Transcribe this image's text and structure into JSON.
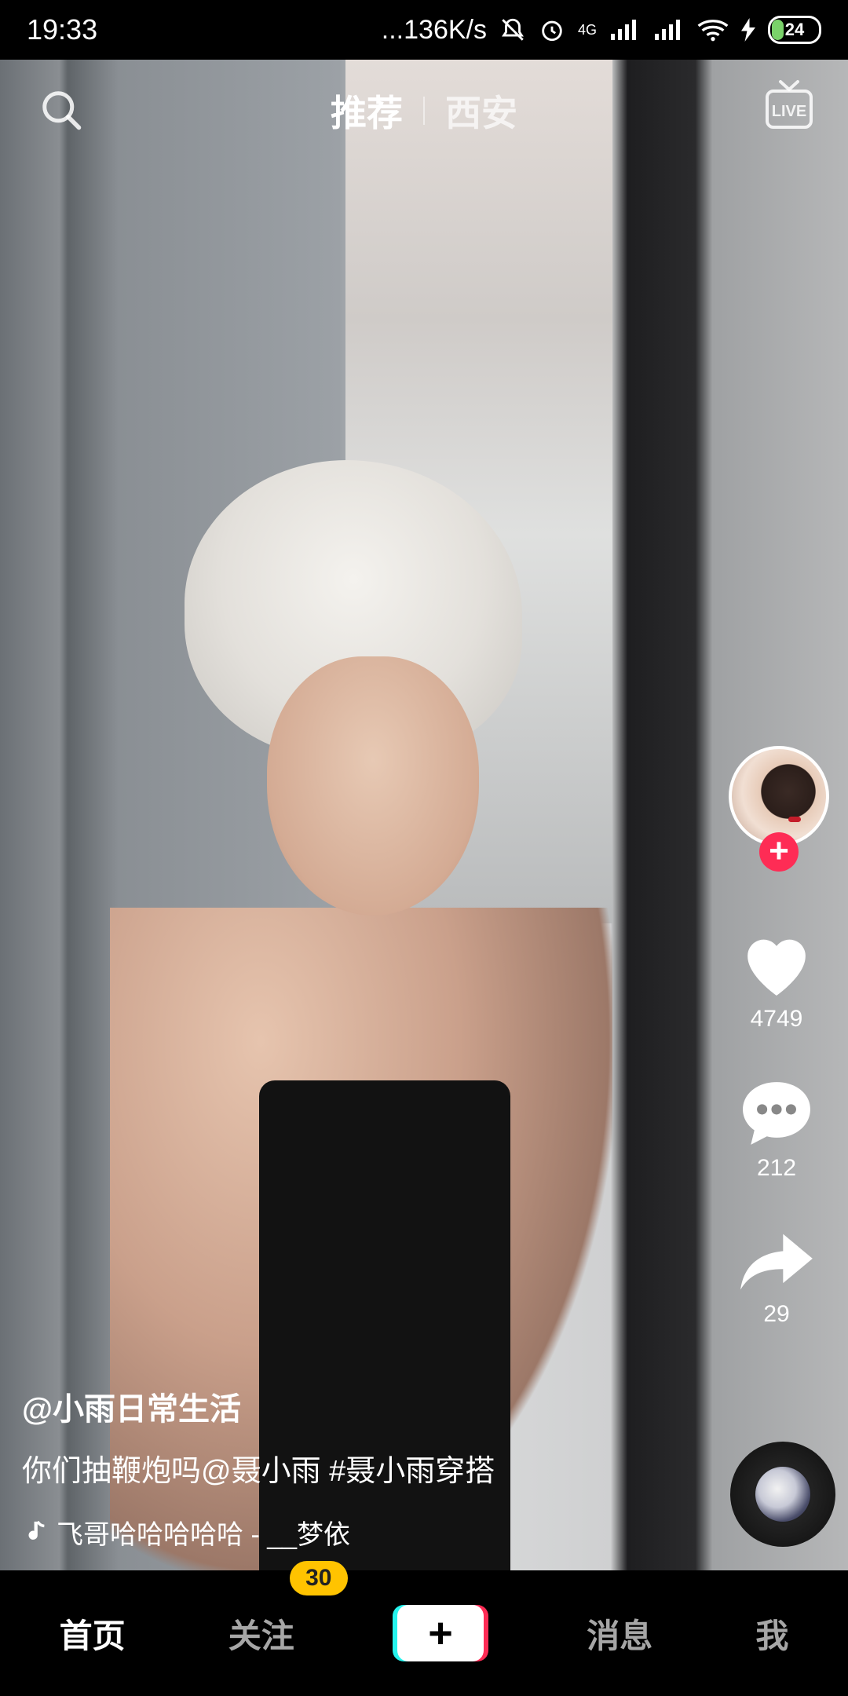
{
  "status_bar": {
    "time": "19:33",
    "network_speed": "...136K/s",
    "network_type": "4G",
    "battery_level": "24"
  },
  "top_nav": {
    "tabs": [
      {
        "label": "推荐",
        "active": true
      },
      {
        "label": "西安",
        "active": false
      }
    ],
    "live_label": "LIVE"
  },
  "right_rail": {
    "like_count": "4749",
    "comment_count": "212",
    "share_count": "29"
  },
  "video_info": {
    "author": "@小雨日常生活",
    "caption": "你们抽鞭炮吗@聂小雨 #聂小雨穿搭",
    "music": "飞哥哈哈哈哈哈 - __梦依"
  },
  "tab_bar": {
    "items": [
      {
        "label": "首页",
        "active": true
      },
      {
        "label": "关注",
        "active": false,
        "badge": "30"
      },
      {
        "label": "+",
        "type": "create"
      },
      {
        "label": "消息",
        "active": false
      },
      {
        "label": "我",
        "active": false
      }
    ]
  },
  "colors": {
    "accent_red": "#fe2c55",
    "accent_cyan": "#25f4ee",
    "badge_yellow": "#ffc300"
  }
}
